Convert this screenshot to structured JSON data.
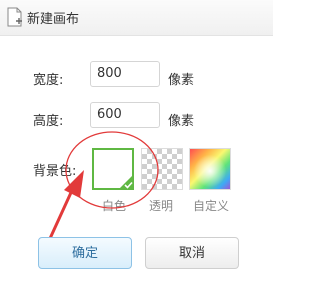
{
  "dialog": {
    "title": "新建画布"
  },
  "fields": {
    "width": {
      "label": "宽度:",
      "value": "800",
      "unit": "像素"
    },
    "height": {
      "label": "高度:",
      "value": "600",
      "unit": "像素"
    }
  },
  "background": {
    "label": "背景色:",
    "options": [
      {
        "label": "白色",
        "selected": true,
        "color": "#ffffff"
      },
      {
        "label": "透明",
        "selected": false
      },
      {
        "label": "自定义",
        "selected": false
      }
    ],
    "selected_border_color": "#5fb843"
  },
  "buttons": {
    "ok": "确定",
    "cancel": "取消"
  },
  "annotation": {
    "color": "#e23a3a",
    "shapes": [
      "circle",
      "arrow"
    ]
  },
  "icons": {
    "title": "new-document-icon",
    "check": "check-icon"
  }
}
